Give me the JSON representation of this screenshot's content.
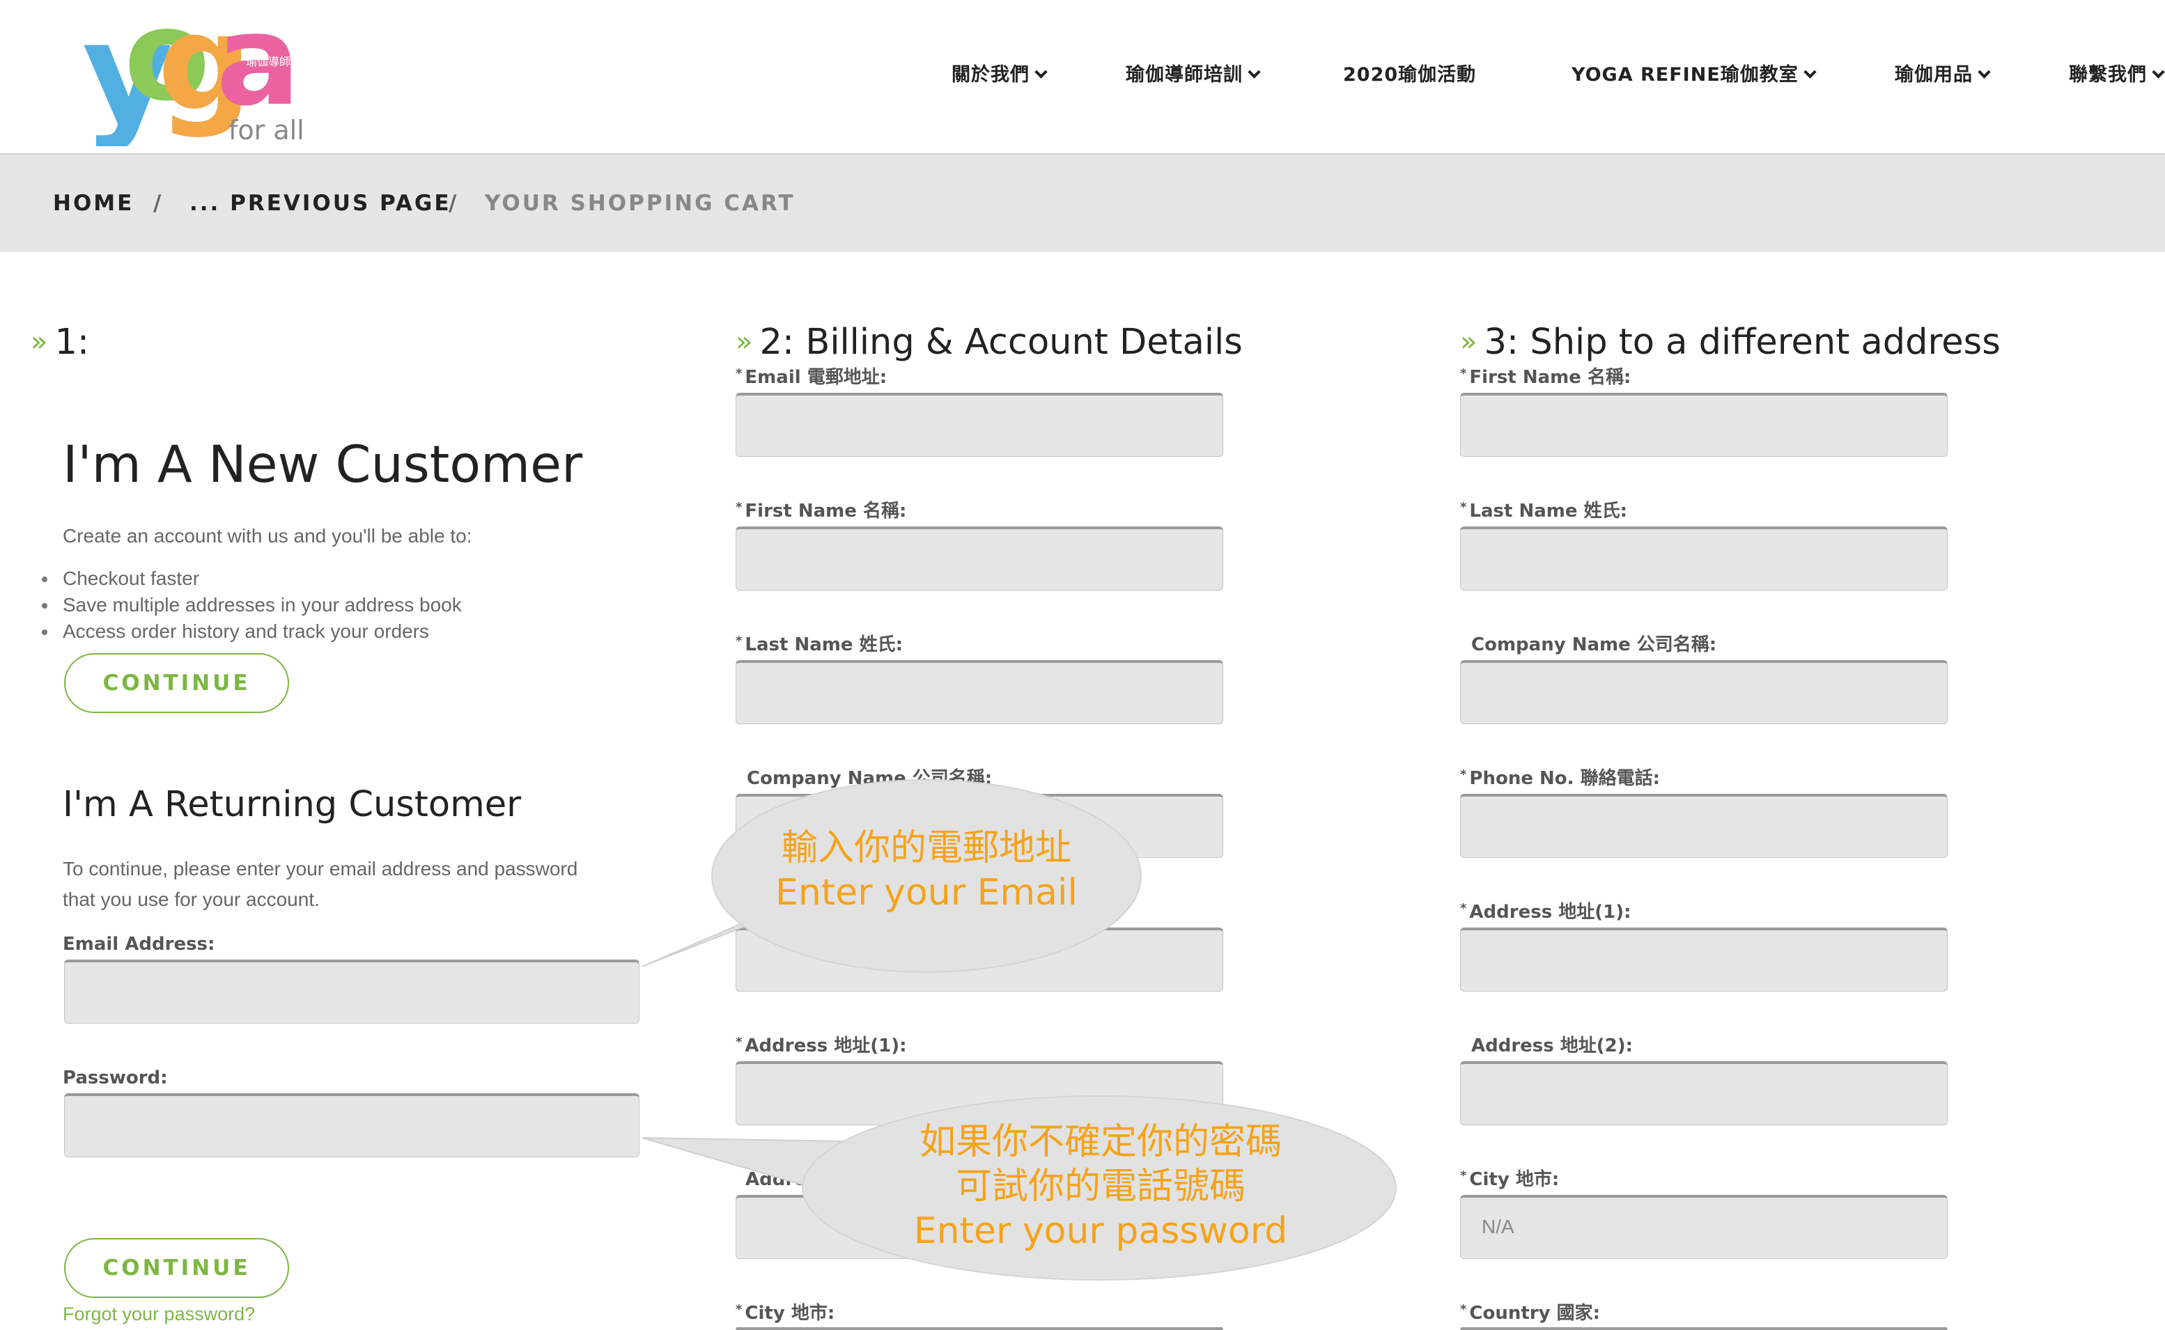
{
  "brand": {
    "logo_letters": [
      "y",
      "o",
      "g",
      "a"
    ],
    "logo_tagline": "for all",
    "logo_small_text": "瑜伽導師",
    "colors": [
      "#3aa6dd",
      "#7cc242",
      "#f39c2c",
      "#e84e93"
    ]
  },
  "nav": [
    {
      "label": "關於我們",
      "dropdown": true
    },
    {
      "label": "瑜伽導師培訓",
      "dropdown": true
    },
    {
      "label": "2020瑜伽活動",
      "dropdown": false
    },
    {
      "label": "YOGA REFINE瑜伽教室",
      "dropdown": true
    },
    {
      "label": "瑜伽用品",
      "dropdown": true
    },
    {
      "label": "聯繫我們",
      "dropdown": true
    }
  ],
  "breadcrumb": {
    "home": "HOME",
    "previous": "... PREVIOUS PAGE",
    "current": "YOUR SHOPPING CART",
    "separator": "/"
  },
  "step1": {
    "title": "1:",
    "new_customer": {
      "heading": "I'm A New Customer",
      "intro": "Create an account with us and you'll be able to:",
      "benefits": [
        "Checkout faster",
        "Save multiple addresses in your address book",
        "Access order history and track your orders"
      ],
      "button": "CONTINUE"
    },
    "returning_customer": {
      "heading": "I'm A Returning Customer",
      "intro_line1": "To continue, please enter your email address and password",
      "intro_line2": "that you use for your account.",
      "email_label": "Email Address:",
      "password_label": "Password:",
      "button": "CONTINUE",
      "forgot": "Forgot your password?"
    }
  },
  "step2": {
    "title": "2: Billing & Account Details",
    "fields": [
      {
        "label": "Email 電郵地址:",
        "required": true,
        "value": ""
      },
      {
        "label": "First Name 名稱:",
        "required": true,
        "value": ""
      },
      {
        "label": "Last Name 姓氏:",
        "required": true,
        "value": ""
      },
      {
        "label": "Company Name 公司名稱:",
        "required": false,
        "value": ""
      },
      {
        "label": "",
        "required": false,
        "value": ""
      },
      {
        "label": "Address 地址(1):",
        "required": true,
        "value": ""
      },
      {
        "label": "Addres",
        "required": false,
        "value": ""
      },
      {
        "label": "City 地市:",
        "required": true,
        "value": ""
      }
    ]
  },
  "step3": {
    "title": "3: Ship to a different address",
    "fields": [
      {
        "label": "First Name 名稱:",
        "required": true,
        "value": ""
      },
      {
        "label": "Last Name 姓氏:",
        "required": true,
        "value": ""
      },
      {
        "label": "Company Name 公司名稱:",
        "required": false,
        "value": ""
      },
      {
        "label": "Phone No. 聯絡電話:",
        "required": true,
        "value": ""
      },
      {
        "label": "Address 地址(1):",
        "required": true,
        "value": ""
      },
      {
        "label": "Address 地址(2):",
        "required": false,
        "value": ""
      },
      {
        "label": "City 地市:",
        "required": true,
        "value": "N/A"
      },
      {
        "label": "Country 國家:",
        "required": true,
        "value": ""
      }
    ]
  },
  "callouts": {
    "email": {
      "line1": "輸入你的電郵地址",
      "line2": "Enter your Email"
    },
    "password": {
      "line1": "如果你不確定你的密碼",
      "line2": "可試你的電話號碼",
      "line3": "Enter your password"
    }
  }
}
